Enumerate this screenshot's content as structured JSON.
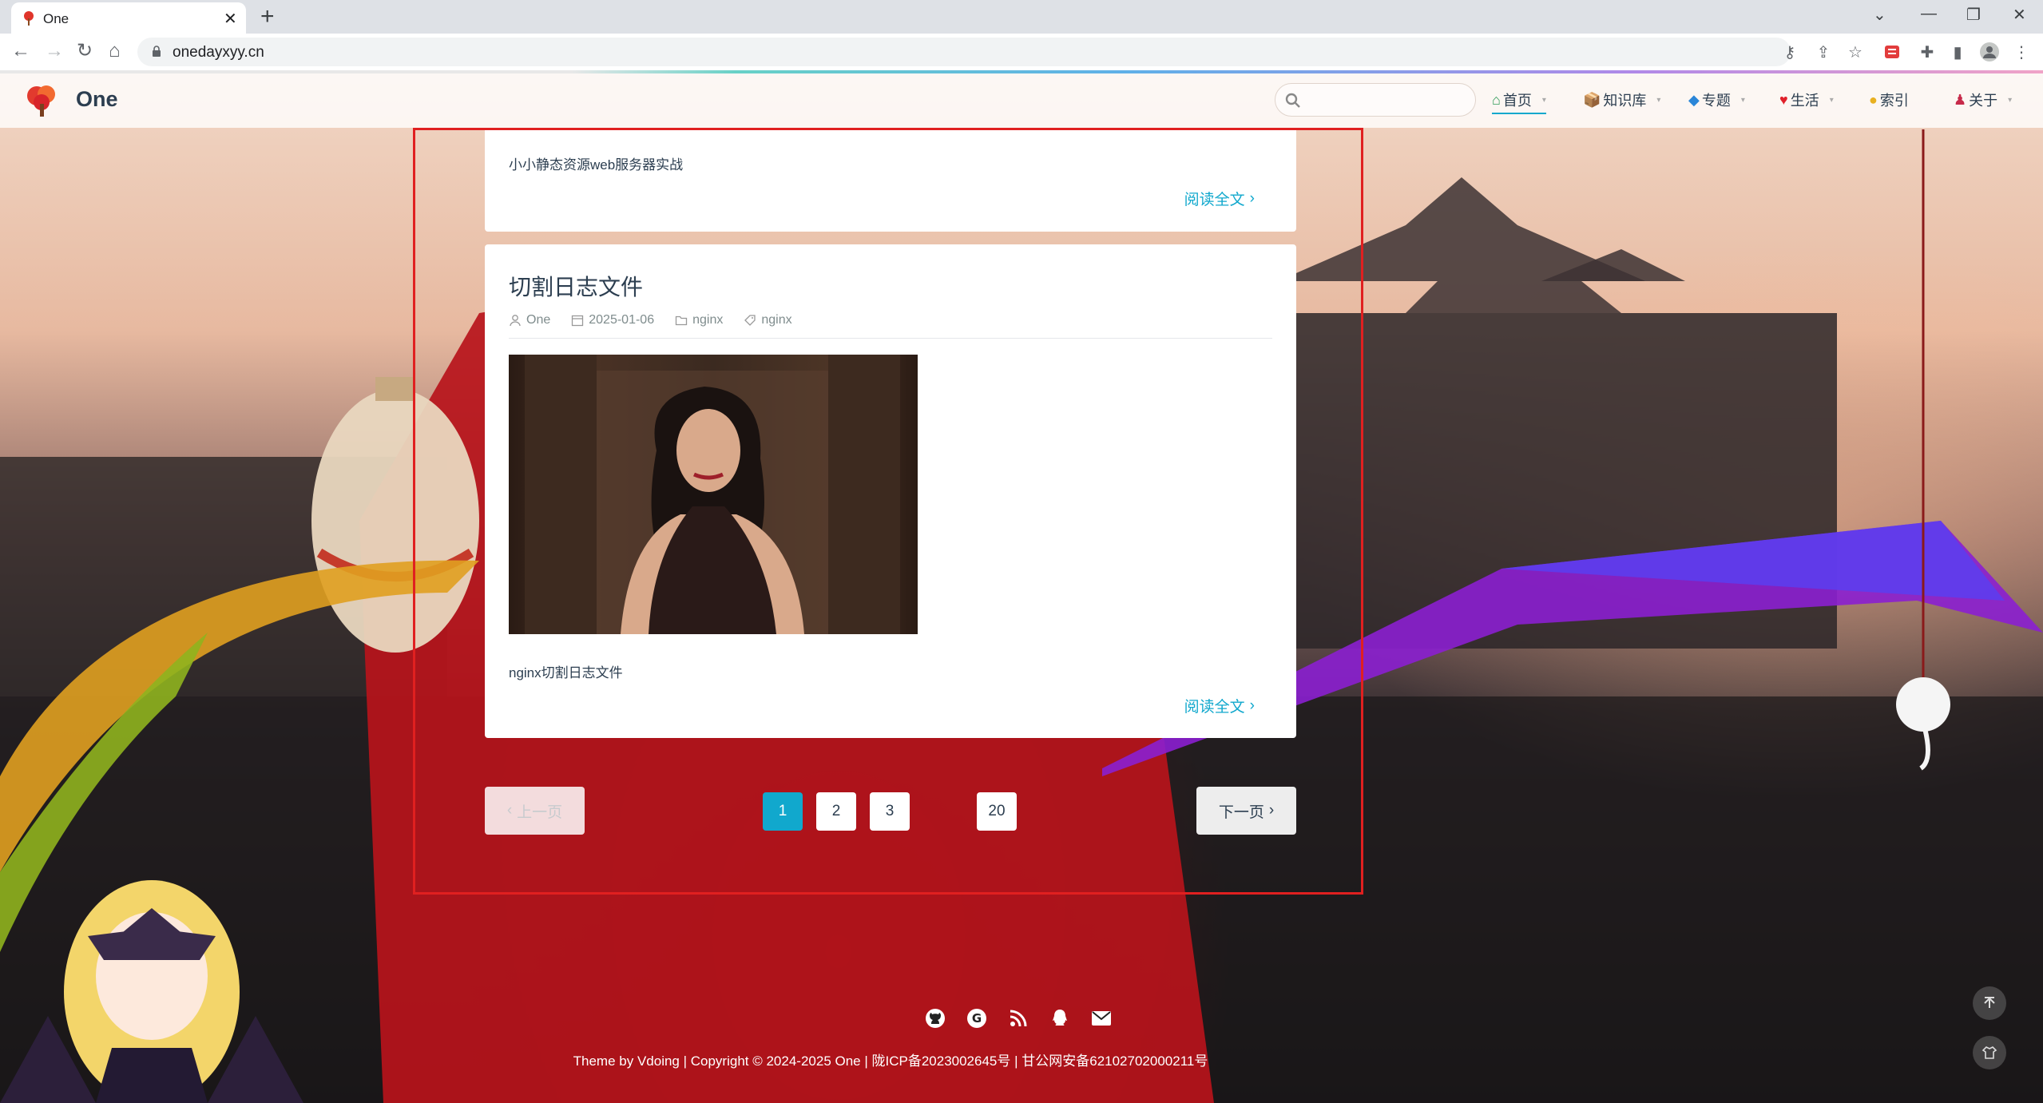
{
  "browser": {
    "tab_title": "One",
    "url": "onedayxyy.cn"
  },
  "site": {
    "name": "One",
    "search_placeholder": "",
    "nav": [
      {
        "label": "首页",
        "active": true
      },
      {
        "label": "知识库"
      },
      {
        "label": "专题"
      },
      {
        "label": "生活"
      },
      {
        "label": "索引"
      },
      {
        "label": "关于"
      }
    ]
  },
  "posts": [
    {
      "excerpt": "小小静态资源web服务器实战",
      "read_more": "阅读全文"
    },
    {
      "title": "切割日志文件",
      "author": "One",
      "date": "2025-01-06",
      "category": "nginx",
      "tag": "nginx",
      "excerpt": "nginx切割日志文件",
      "read_more": "阅读全文"
    }
  ],
  "pagination": {
    "prev": "上一页",
    "next": "下一页",
    "pages": [
      "1",
      "2",
      "3",
      "20"
    ],
    "current": "1"
  },
  "footer": {
    "icons": [
      "github-icon",
      "gitee-icon",
      "rss-icon",
      "qq-icon",
      "email-icon"
    ],
    "text": "Theme by Vdoing | Copyright © 2024-2025 One | 陇ICP备2023002645号 | 甘公网安备62102702000211号"
  },
  "colors": {
    "accent": "#11a8cd",
    "annotation": "#e02020",
    "text": "#2c3e50"
  }
}
